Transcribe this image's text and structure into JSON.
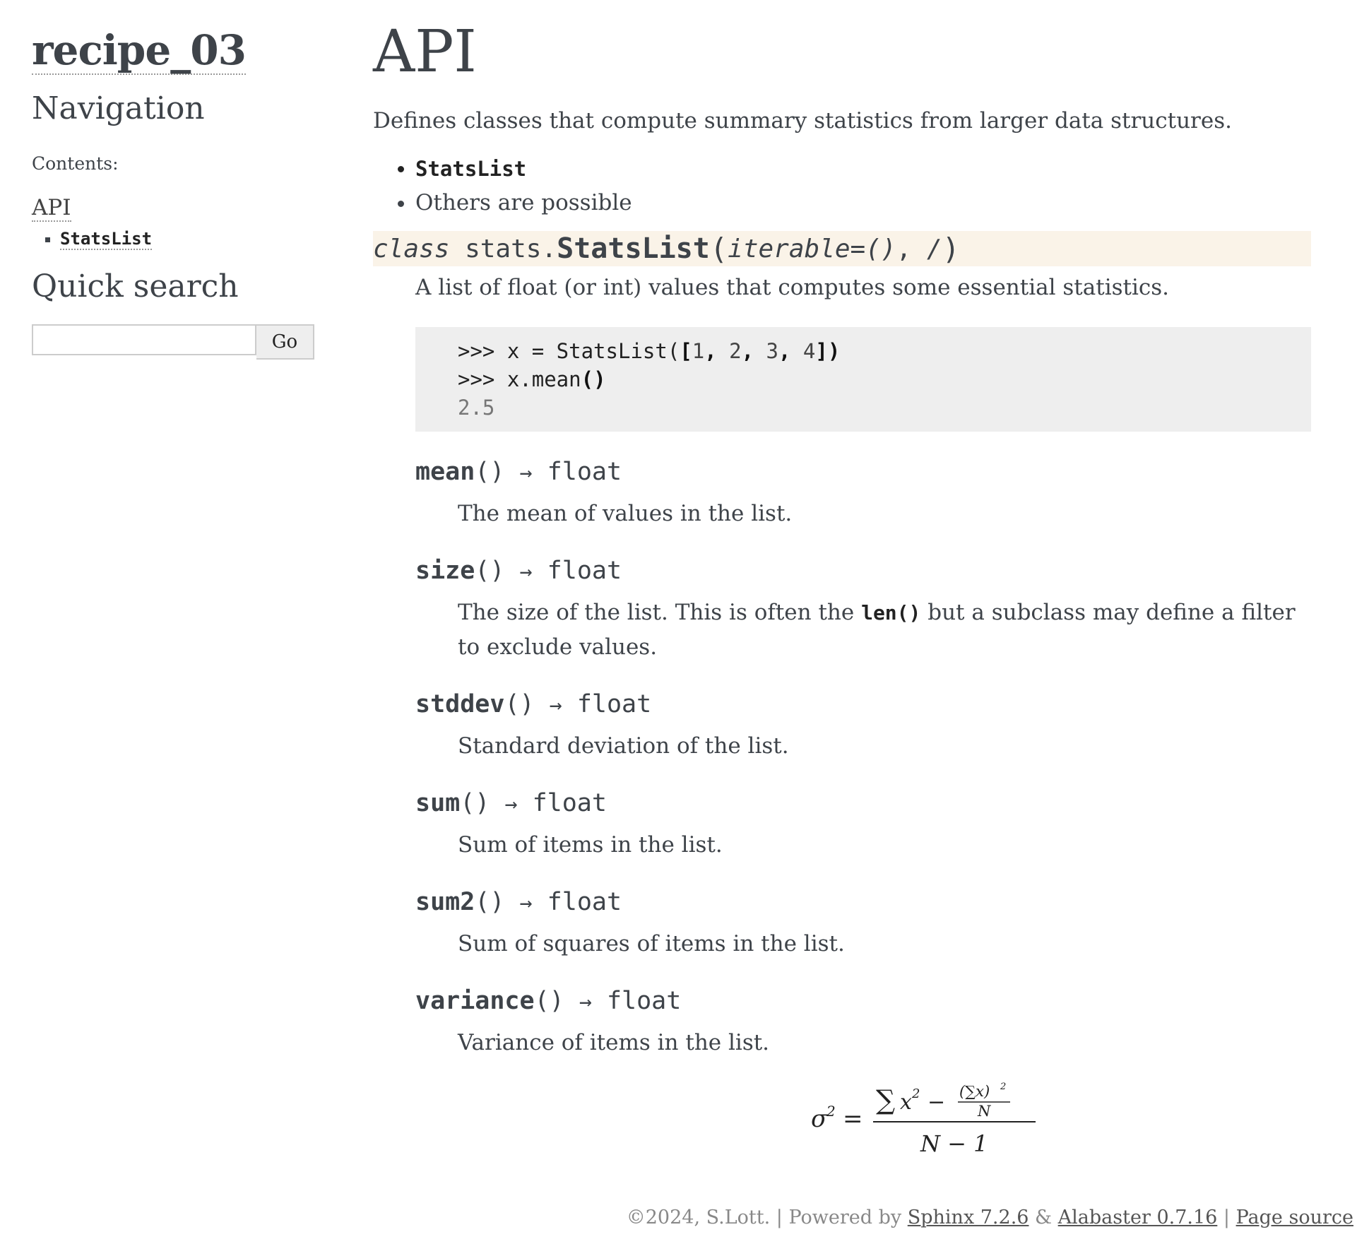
{
  "sidebar": {
    "logo": "recipe_03",
    "navigation_heading": "Navigation",
    "contents_label": "Contents:",
    "toc_top": "API",
    "toc_sub": "StatsList",
    "search_heading": "Quick search",
    "search_placeholder": "",
    "search_button": "Go"
  },
  "main": {
    "title": "API",
    "intro": "Defines classes that compute summary statistics from larger data structures.",
    "bullets": [
      "StatsList",
      "Others are possible"
    ],
    "class_sig": {
      "keyword": "class",
      "module": "stats.",
      "name": "StatsList",
      "open": "(",
      "param": "iterable=()",
      "sep": ",",
      "slash": "/",
      "close": ")"
    },
    "class_desc": "A list of float (or int) values that computes some essential statistics.",
    "code": {
      "line1_prompt": ">>> ",
      "line1_a": "x = StatsList(",
      "line1_b": "[",
      "line1_n1": "1",
      "line1_n2": "2",
      "line1_n3": "3",
      "line1_n4": "4",
      "line1_c": "])",
      "line2_prompt": ">>> ",
      "line2_a": "x.mean",
      "line2_b": "()",
      "line3": "2.5"
    },
    "methods": [
      {
        "name": "mean",
        "parens": "()",
        "arrow": "→",
        "ret": "float",
        "desc": "The mean of values in the list."
      },
      {
        "name": "size",
        "parens": "()",
        "arrow": "→",
        "ret": "float",
        "desc_a": "The size of the list. This is often the ",
        "desc_code": "len()",
        "desc_b": " but a subclass may define a filter to exclude values."
      },
      {
        "name": "stddev",
        "parens": "()",
        "arrow": "→",
        "ret": "float",
        "desc": "Standard deviation of the list."
      },
      {
        "name": "sum",
        "parens": "()",
        "arrow": "→",
        "ret": "float",
        "desc": "Sum of items in the list."
      },
      {
        "name": "sum2",
        "parens": "()",
        "arrow": "→",
        "ret": "float",
        "desc": "Sum of squares of items in the list."
      },
      {
        "name": "variance",
        "parens": "()",
        "arrow": "→",
        "ret": "float",
        "desc": "Variance of items in the list."
      }
    ],
    "formula": {
      "lhs": "σ",
      "lhs_sup": "2",
      "eq": "=",
      "num_sum": "∑",
      "num_x": "x",
      "num_sup": "2",
      "num_minus": "−",
      "inner_num": "(∑x)",
      "inner_sup": "2",
      "inner_den": "N",
      "den": "N − 1"
    }
  },
  "footer": {
    "copyright": "©2024, S.Lott. | Powered by ",
    "sphinx": "Sphinx 7.2.6",
    "amp": " & ",
    "alabaster": "Alabaster 0.7.16",
    "sep": " | ",
    "page_source": "Page source"
  }
}
